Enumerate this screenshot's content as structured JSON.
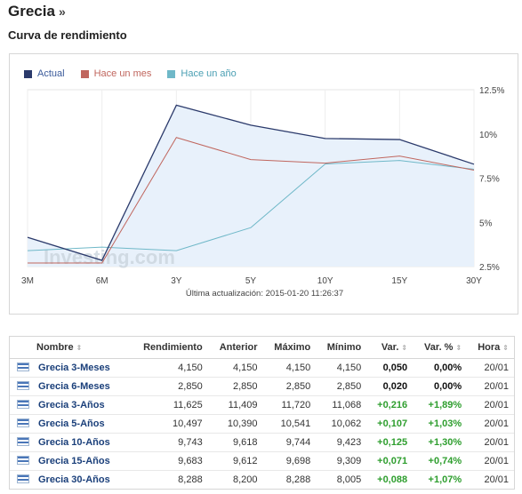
{
  "header": {
    "title": "Grecia",
    "title_suffix": "»",
    "section": "Curva de rendimiento"
  },
  "chart": {
    "updated": "Última actualización: 2015-01-20 11:26:37",
    "watermark": "Investing.com",
    "colors": {
      "actual": "#2b3a6b",
      "mes": "#c0665e",
      "ano": "#6fb8c8",
      "area": "#e8f1fb"
    }
  },
  "chart_data": {
    "type": "line",
    "categories": [
      "3M",
      "6M",
      "3Y",
      "5Y",
      "10Y",
      "15Y",
      "30Y"
    ],
    "series": [
      {
        "name": "Actual",
        "values": [
          4.15,
          2.85,
          11.625,
          10.497,
          9.743,
          9.683,
          8.288
        ]
      },
      {
        "name": "Hace un mes",
        "values": [
          2.7,
          2.7,
          9.8,
          8.55,
          8.35,
          8.75,
          7.95
        ]
      },
      {
        "name": "Hace un año",
        "values": [
          3.4,
          3.6,
          3.4,
          4.7,
          8.3,
          8.5,
          8.0
        ]
      }
    ],
    "ylim": [
      2.5,
      12.5
    ],
    "y_ticks": [
      "12.5%",
      "10%",
      "7.5%",
      "5%",
      "2.5%"
    ],
    "y_tick_values": [
      12.5,
      10,
      7.5,
      5,
      2.5
    ],
    "legend": "top-left",
    "grid": true
  },
  "table": {
    "headers": {
      "name": "Nombre",
      "yield": "Rendimiento",
      "prev": "Anterior",
      "max": "Máximo",
      "min": "Mínimo",
      "chg": "Var.",
      "chg_pct": "Var. %",
      "time": "Hora"
    },
    "sort_icon": "⇕",
    "rows": [
      {
        "name": "Grecia 3-Meses",
        "yield": "4,150",
        "prev": "4,150",
        "max": "4,150",
        "min": "4,150",
        "chg": "0,050",
        "chg_pct": "0,00%",
        "time": "20/01",
        "dir": "neutral"
      },
      {
        "name": "Grecia 6-Meses",
        "yield": "2,850",
        "prev": "2,850",
        "max": "2,850",
        "min": "2,850",
        "chg": "0,020",
        "chg_pct": "0,00%",
        "time": "20/01",
        "dir": "neutral"
      },
      {
        "name": "Grecia 3-Años",
        "yield": "11,625",
        "prev": "11,409",
        "max": "11,720",
        "min": "11,068",
        "chg": "+0,216",
        "chg_pct": "+1,89%",
        "time": "20/01",
        "dir": "pos"
      },
      {
        "name": "Grecia 5-Años",
        "yield": "10,497",
        "prev": "10,390",
        "max": "10,541",
        "min": "10,062",
        "chg": "+0,107",
        "chg_pct": "+1,03%",
        "time": "20/01",
        "dir": "pos"
      },
      {
        "name": "Grecia 10-Años",
        "yield": "9,743",
        "prev": "9,618",
        "max": "9,744",
        "min": "9,423",
        "chg": "+0,125",
        "chg_pct": "+1,30%",
        "time": "20/01",
        "dir": "pos"
      },
      {
        "name": "Grecia 15-Años",
        "yield": "9,683",
        "prev": "9,612",
        "max": "9,698",
        "min": "9,309",
        "chg": "+0,071",
        "chg_pct": "+0,74%",
        "time": "20/01",
        "dir": "pos"
      },
      {
        "name": "Grecia 30-Años",
        "yield": "8,288",
        "prev": "8,200",
        "max": "8,288",
        "min": "8,005",
        "chg": "+0,088",
        "chg_pct": "+1,07%",
        "time": "20/01",
        "dir": "pos"
      }
    ]
  }
}
